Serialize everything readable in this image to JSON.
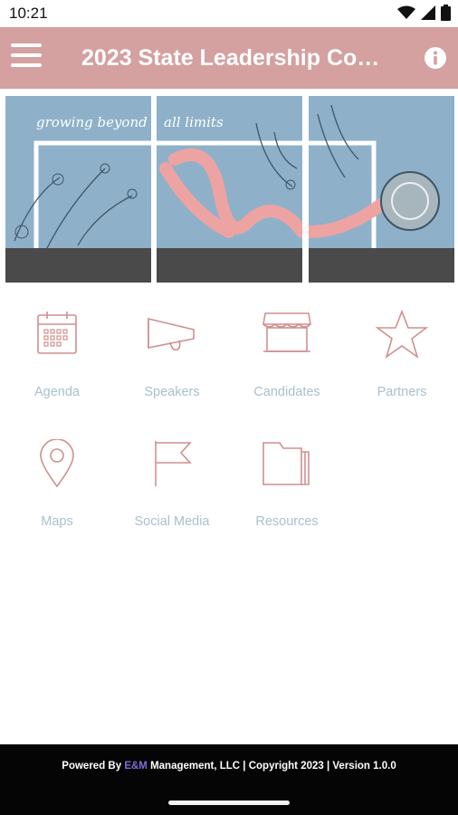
{
  "status_bar": {
    "time": "10:21"
  },
  "app_bar": {
    "title": "2023 State Leadership Conf..."
  },
  "banner": {
    "script_text_left": "growing beyond",
    "script_text_right": "all limits"
  },
  "tiles": [
    {
      "label": "Agenda",
      "icon": "calendar-icon"
    },
    {
      "label": "Speakers",
      "icon": "megaphone-icon"
    },
    {
      "label": "Candidates",
      "icon": "storefront-icon"
    },
    {
      "label": "Partners",
      "icon": "star-icon"
    },
    {
      "label": "Maps",
      "icon": "map-pin-icon"
    },
    {
      "label": "Social Media",
      "icon": "flag-icon"
    },
    {
      "label": "Resources",
      "icon": "folder-icon"
    }
  ],
  "footer": {
    "prefix": "Powered By ",
    "brand": "E&M",
    "suffix": " Management, LLC | Copyright 2023 | Version 1.0.0"
  },
  "colors": {
    "app_bar": "#d5a0a0",
    "icon_stroke": "#d08f8f",
    "tile_label": "#a9c0cd",
    "banner_sky": "#8eb1c9",
    "ribbon": "#eea3a3",
    "footer_bg": "#050505",
    "footer_brand": "#7b6fd6"
  }
}
